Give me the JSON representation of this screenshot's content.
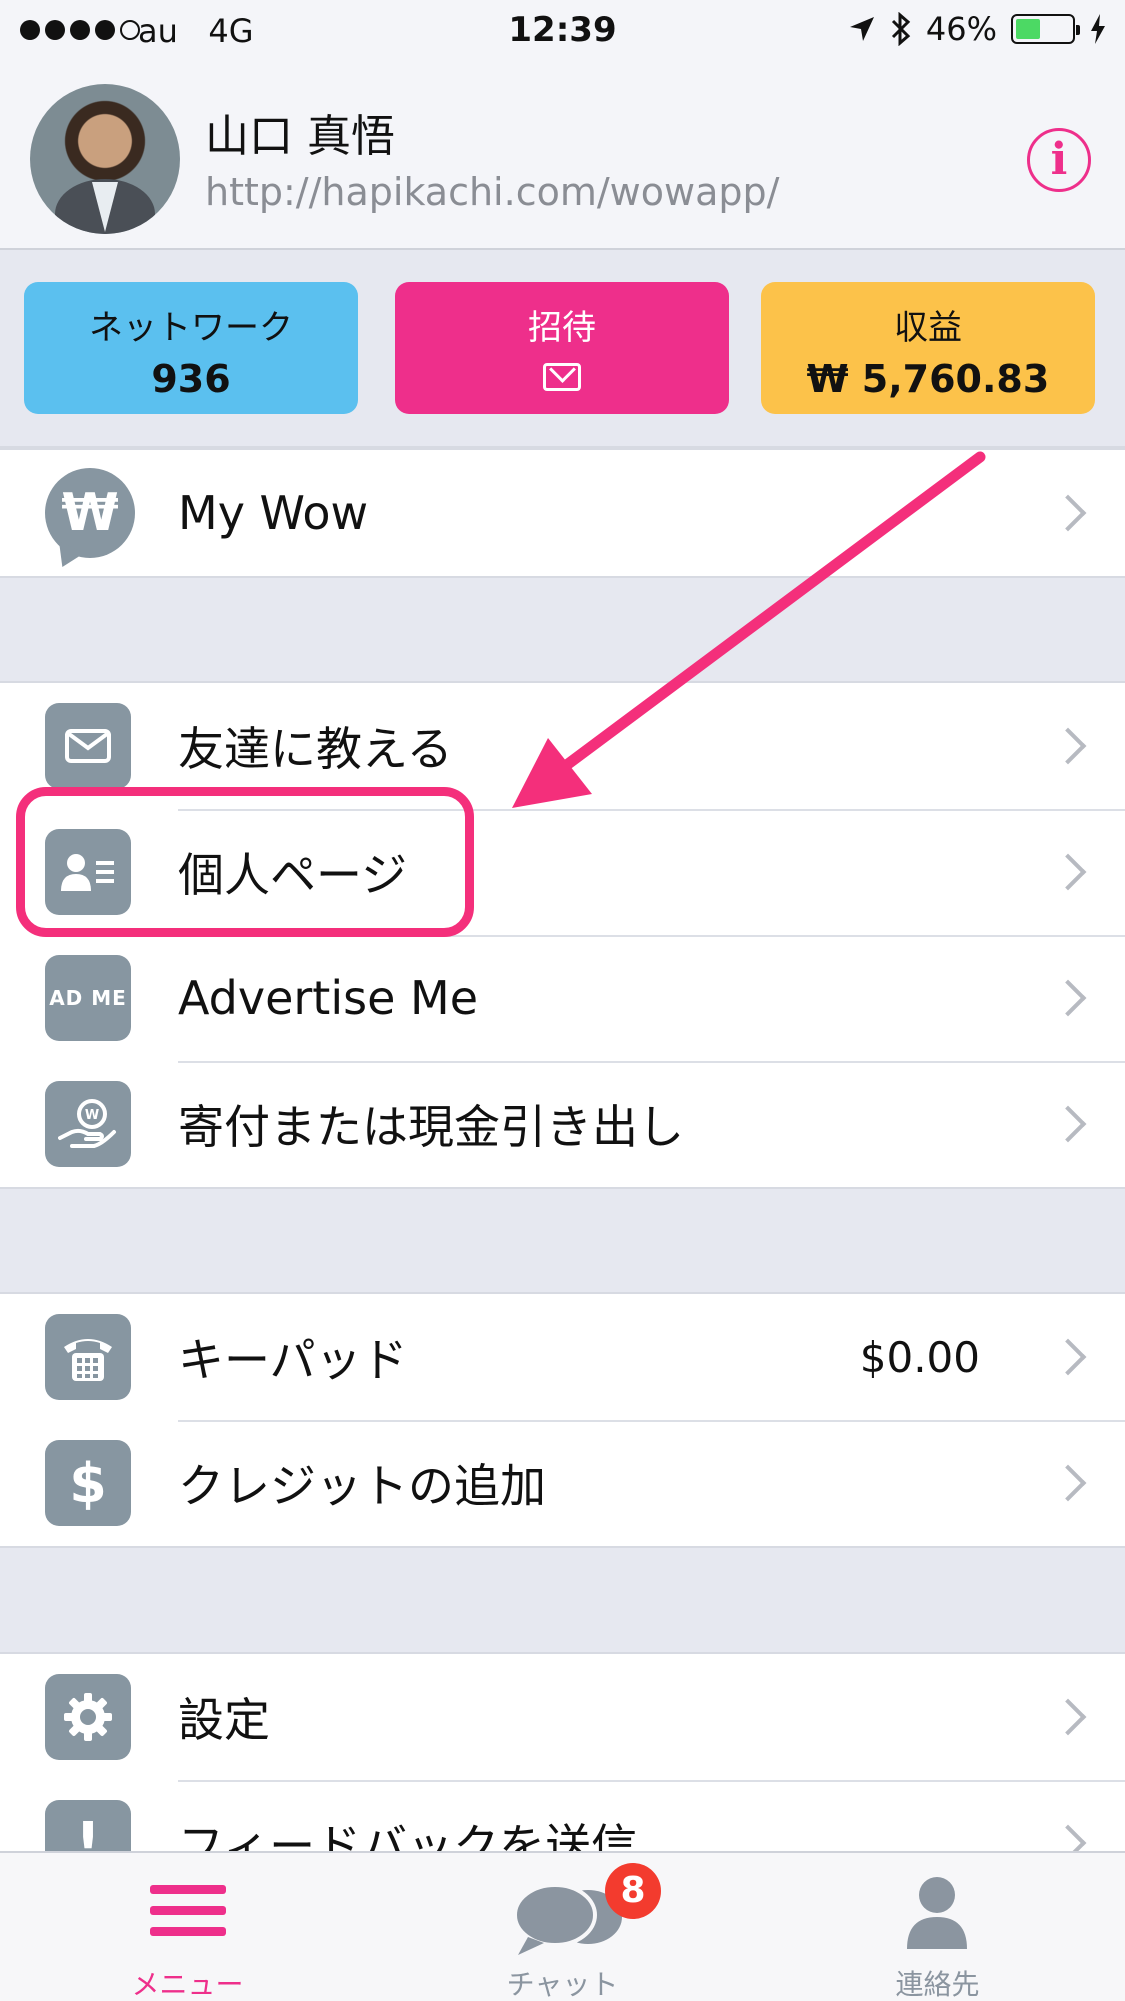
{
  "status_bar": {
    "carrier": "au",
    "network": "4G",
    "time": "12:39",
    "battery": "46%",
    "battery_level": 0.46
  },
  "profile": {
    "name": "山口 真悟",
    "url": "http://hapikachi.com/wowapp/",
    "info_icon": "i"
  },
  "cards": {
    "network": {
      "label": "ネットワーク",
      "value": "936"
    },
    "invite": {
      "label": "招待",
      "icon": "mail-icon"
    },
    "earnings": {
      "label": "収益",
      "value": "₩ 5,760.83"
    }
  },
  "menu": {
    "group1": [
      {
        "label": "My Wow",
        "icon": "wow-icon"
      }
    ],
    "group2": [
      {
        "label": "友達に教える",
        "icon": "mail-icon"
      },
      {
        "label": "個人ページ",
        "icon": "profile-card-icon"
      },
      {
        "label": "Advertise Me",
        "icon": "ad-me-icon",
        "icon_text": "AD ME"
      },
      {
        "label": "寄付または現金引き出し",
        "icon": "donate-hand-icon"
      }
    ],
    "group3": [
      {
        "label": "キーパッド",
        "icon": "phone-keypad-icon",
        "value": "$0.00"
      },
      {
        "label": "クレジットの追加",
        "icon": "dollar-icon",
        "icon_text": "$"
      }
    ],
    "group4": [
      {
        "label": "設定",
        "icon": "gear-icon"
      },
      {
        "label": "フィードバックを送信",
        "icon": "exclamation-icon",
        "icon_text": "!"
      }
    ]
  },
  "tabbar": {
    "menu": "メニュー",
    "chat": "チャット",
    "chat_badge": "8",
    "contacts": "連絡先"
  },
  "colors": {
    "accent_pink": "#ee2f8b",
    "network_blue": "#5bc0ef",
    "earnings_yellow": "#fcc24a",
    "icon_gray": "#8796a1"
  }
}
